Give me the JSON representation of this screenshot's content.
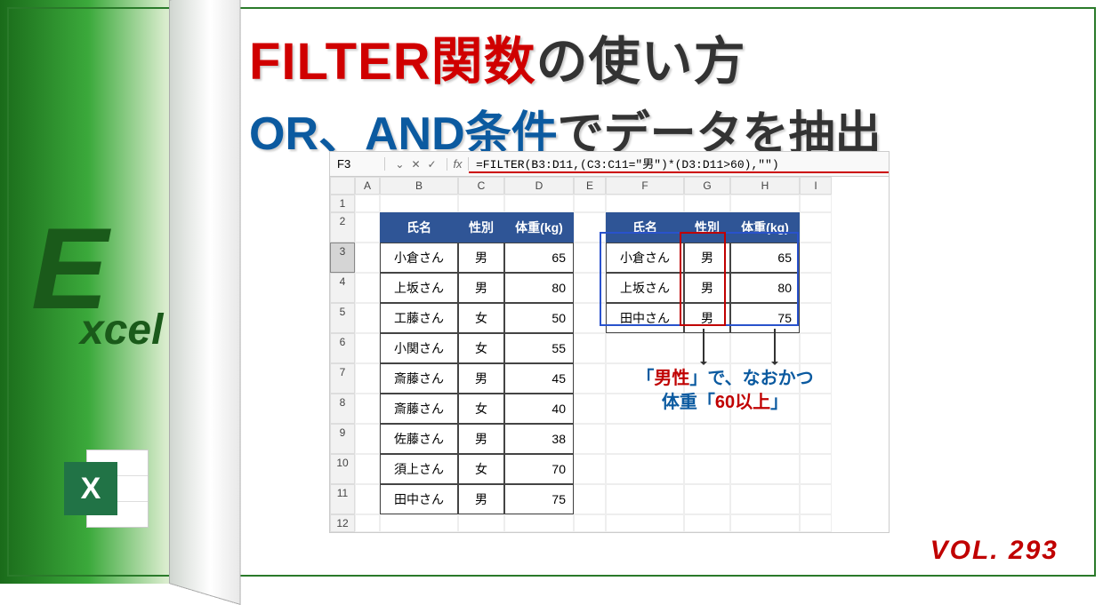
{
  "headline": {
    "filter_fn": "FILTER関数",
    "usage": "の使い方",
    "or_and": "OR、AND条件",
    "extract": "でデータを抽出"
  },
  "left": {
    "e": "E",
    "xcel": "xcel",
    "badge": "X"
  },
  "sheet": {
    "cell_ref": "F3",
    "fx": "fx",
    "formula": "=FILTER(B3:D11,(C3:C11=\"男\")*(D3:D11>60),\"\")",
    "cols": [
      "A",
      "B",
      "C",
      "D",
      "E",
      "F",
      "G",
      "H",
      "I"
    ],
    "headers": {
      "name": "氏名",
      "gender": "性別",
      "weight": "体重(kg)"
    },
    "rows": [
      {
        "name": "小倉さん",
        "gender": "男",
        "weight": "65"
      },
      {
        "name": "上坂さん",
        "gender": "男",
        "weight": "80"
      },
      {
        "name": "工藤さん",
        "gender": "女",
        "weight": "50"
      },
      {
        "name": "小関さん",
        "gender": "女",
        "weight": "55"
      },
      {
        "name": "斎藤さん",
        "gender": "男",
        "weight": "45"
      },
      {
        "name": "斎藤さん",
        "gender": "女",
        "weight": "40"
      },
      {
        "name": "佐藤さん",
        "gender": "男",
        "weight": "38"
      },
      {
        "name": "須上さん",
        "gender": "女",
        "weight": "70"
      },
      {
        "name": "田中さん",
        "gender": "男",
        "weight": "75"
      }
    ],
    "result": [
      {
        "name": "小倉さん",
        "gender": "男",
        "weight": "65"
      },
      {
        "name": "上坂さん",
        "gender": "男",
        "weight": "80"
      },
      {
        "name": "田中さん",
        "gender": "男",
        "weight": "75"
      }
    ]
  },
  "callout": {
    "open1": "「",
    "male": "男性",
    "mid1": "」で、なおかつ",
    "line2a": "体重「",
    "sixty": "60以上",
    "line2b": "」"
  },
  "vol": "VOL. 293",
  "chart_data": {
    "type": "table",
    "title": "FILTER example: extract rows where gender=男 AND weight>60",
    "source_headers": [
      "氏名",
      "性別",
      "体重(kg)"
    ],
    "source_rows": [
      [
        "小倉さん",
        "男",
        65
      ],
      [
        "上坂さん",
        "男",
        80
      ],
      [
        "工藤さん",
        "女",
        50
      ],
      [
        "小関さん",
        "女",
        55
      ],
      [
        "斎藤さん",
        "男",
        45
      ],
      [
        "斎藤さん",
        "女",
        40
      ],
      [
        "佐藤さん",
        "男",
        38
      ],
      [
        "須上さん",
        "女",
        70
      ],
      [
        "田中さん",
        "男",
        75
      ]
    ],
    "result_rows": [
      [
        "小倉さん",
        "男",
        65
      ],
      [
        "上坂さん",
        "男",
        80
      ],
      [
        "田中さん",
        "男",
        75
      ]
    ],
    "formula": "=FILTER(B3:D11,(C3:C11=\"男\")*(D3:D11>60),\"\")"
  }
}
